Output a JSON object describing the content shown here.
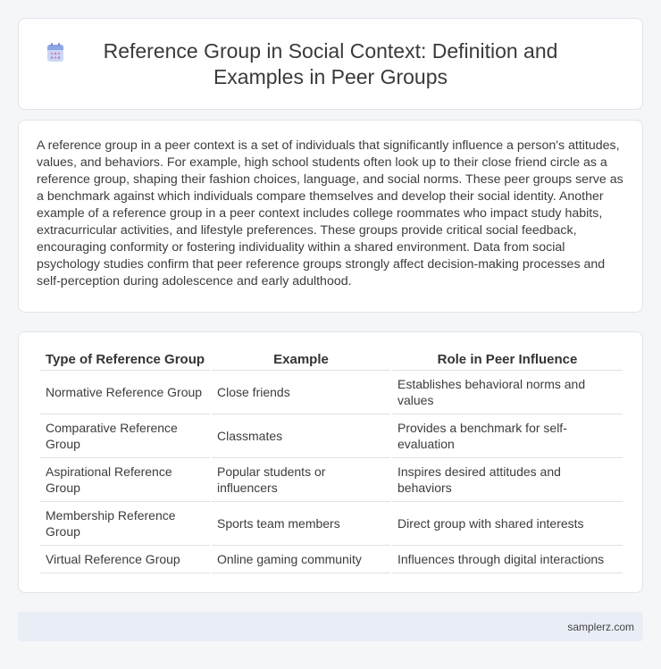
{
  "header": {
    "icon": "calendar-doc-icon",
    "title": "Reference Group in Social Context: Definition and Examples in Peer Groups"
  },
  "intro": {
    "text": "A reference group in a peer context is a set of individuals that significantly influence a person's attitudes, values, and behaviors. For example, high school students often look up to their close friend circle as a reference group, shaping their fashion choices, language, and social norms. These peer groups serve as a benchmark against which individuals compare themselves and develop their social identity. Another example of a reference group in a peer context includes college roommates who impact study habits, extracurricular activities, and lifestyle preferences. These groups provide critical social feedback, encouraging conformity or fostering individuality within a shared environment. Data from social psychology studies confirm that peer reference groups strongly affect decision-making processes and self-perception during adolescence and early adulthood."
  },
  "table": {
    "headers": [
      "Type of Reference Group",
      "Example",
      "Role in Peer Influence"
    ],
    "rows": [
      [
        "Normative Reference Group",
        "Close friends",
        "Establishes behavioral norms and values"
      ],
      [
        "Comparative Reference Group",
        "Classmates",
        "Provides a benchmark for self-evaluation"
      ],
      [
        "Aspirational Reference Group",
        "Popular students or influencers",
        "Inspires desired attitudes and behaviors"
      ],
      [
        "Membership Reference Group",
        "Sports team members",
        "Direct group with shared interests"
      ],
      [
        "Virtual Reference Group",
        "Online gaming community",
        "Influences through digital interactions"
      ]
    ]
  },
  "footer": {
    "site": "samplerz.com"
  }
}
